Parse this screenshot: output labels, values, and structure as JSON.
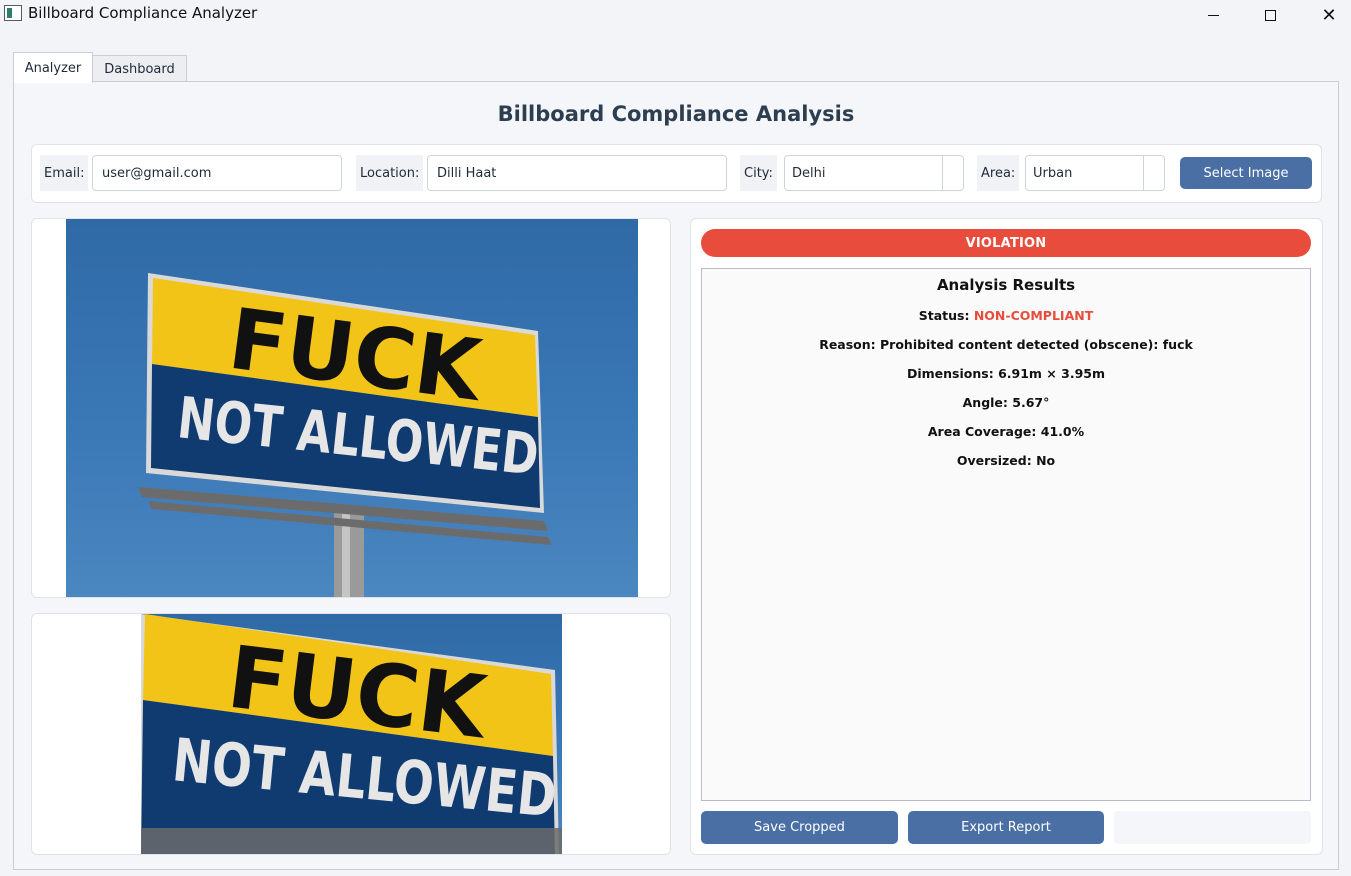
{
  "window": {
    "title": "Billboard Compliance Analyzer"
  },
  "tabs": [
    {
      "label": "Analyzer"
    },
    {
      "label": "Dashboard"
    }
  ],
  "page": {
    "title": "Billboard Compliance Analysis"
  },
  "form": {
    "email_label": "Email:",
    "email_value": "user@gmail.com",
    "location_label": "Location:",
    "location_value": "Dilli Haat",
    "city_label": "City:",
    "city_value": "Delhi",
    "area_label": "Area:",
    "area_value": "Urban",
    "select_image_label": "Select Image"
  },
  "billboard": {
    "line1": "FUCK",
    "line2": "NOT ALLOWED"
  },
  "results": {
    "badge": "VIOLATION",
    "title": "Analysis Results",
    "status_label": "Status:",
    "status_value": "NON-COMPLIANT",
    "reason_label": "Reason:",
    "reason_value": "Prohibited content detected (obscene): fuck",
    "dimensions_label": "Dimensions:",
    "dimensions_value": "6.91m × 3.95m",
    "angle_label": "Angle:",
    "angle_value": "5.67°",
    "coverage_label": "Area Coverage:",
    "coverage_value": "41.0%",
    "oversized_label": "Oversized:",
    "oversized_value": "No"
  },
  "actions": {
    "save_cropped": "Save Cropped",
    "export_report": "Export Report"
  },
  "colors": {
    "accent": "#4a6fa5",
    "violation": "#e74c3c",
    "sign_yellow": "#f2c417",
    "sign_blue": "#0f3b70"
  }
}
